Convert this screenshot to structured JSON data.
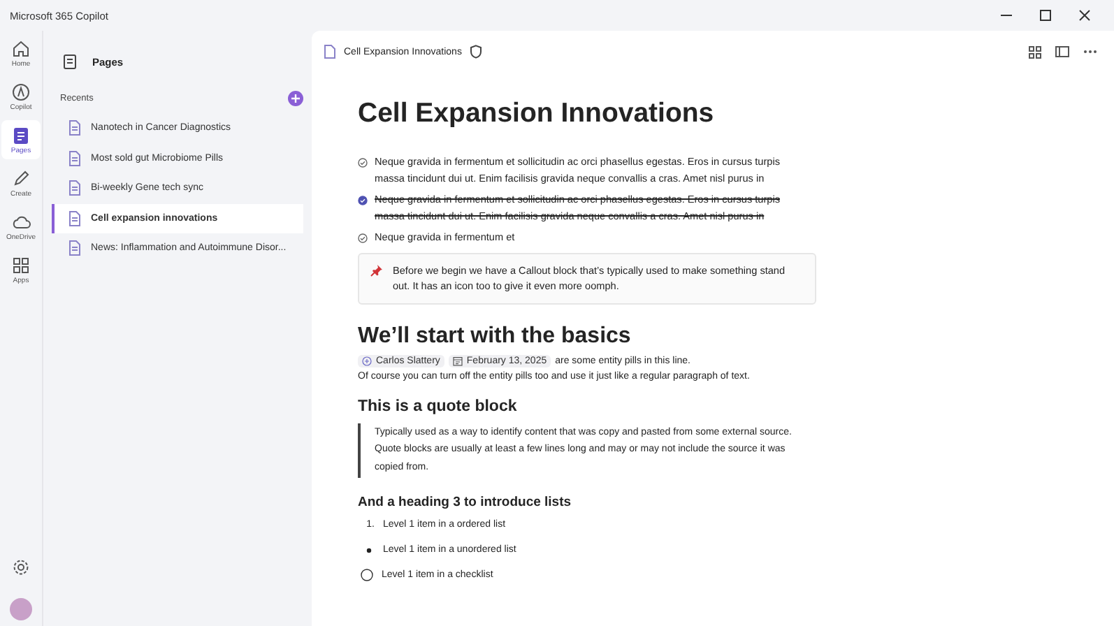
{
  "window": {
    "title": "Microsoft 365 Copilot"
  },
  "nav": [
    {
      "label": "Home",
      "selected": false
    },
    {
      "label": "Copilot",
      "selected": false
    },
    {
      "label": "Pages",
      "selected": true
    },
    {
      "label": "Create",
      "selected": false
    },
    {
      "label": "OneDrive",
      "selected": false
    },
    {
      "label": "Apps",
      "selected": false
    }
  ],
  "sidebar": {
    "title": "Pages",
    "section": "Recents",
    "items": [
      {
        "label": "Nanotech in Cancer Diagnostics",
        "selected": false
      },
      {
        "label": "Most sold gut Microbiome Pills",
        "selected": false
      },
      {
        "label": "Bi-weekly Gene tech sync",
        "selected": false
      },
      {
        "label": "Cell expansion innovations",
        "selected": true
      },
      {
        "label": "News: Inflammation and Autoimmune Disor...",
        "selected": false
      }
    ]
  },
  "page": {
    "breadcrumb": "Cell Expansion Innovations",
    "title": "Cell Expansion Innovations",
    "tasks": [
      {
        "text": "Neque gravida in fermentum et sollicitudin ac orci phasellus egestas. Eros in cursus turpis massa tincidunt dui ut. Enim facilisis gravida neque convallis a cras. Amet nisl purus in",
        "checked": false
      },
      {
        "text": "Neque gravida in fermentum et sollicitudin ac orci phasellus egestas. Eros in cursus turpis massa tincidunt dui ut. Enim facilisis gravida neque convallis a cras. Amet nisl purus in",
        "checked": true
      },
      {
        "text": "Neque gravida in fermentum et",
        "checked": false
      }
    ],
    "callout": "Before we begin we have a Callout block that’s typically used to make something stand out. It has an icon too to give it even more oomph.",
    "heading2": "We’ll start with the basics",
    "pills": [
      {
        "kind": "person",
        "label": "Carlos Slattery"
      },
      {
        "kind": "date",
        "label": "February 13, 2025"
      }
    ],
    "pills_tail": "are some entity pills in this line.",
    "paragraph": "Of course you can turn off the entity pills too and use it just like a regular paragraph of text.",
    "heading_quote": "This is a quote block",
    "quote": "Typically used as a way to identify content that was copy and pasted from some external source. Quote blocks are usually at least a few lines long and may or may not include the source it was copied from.",
    "heading3": "And a heading 3 to introduce lists",
    "list": [
      {
        "kind": "ordered",
        "marker": "1.",
        "text": "Level 1 item in a ordered list"
      },
      {
        "kind": "bullet",
        "text": "Level 1 item in a unordered list"
      },
      {
        "kind": "checklist",
        "text": "Level 1 item in a checklist",
        "checked": false
      }
    ]
  }
}
